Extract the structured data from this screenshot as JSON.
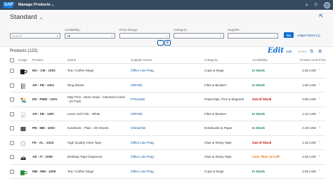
{
  "shell": {
    "logo_text": "SAP",
    "app_title": "Manage Products",
    "icons": [
      "search-icon",
      "notification-icon",
      "user-avatar"
    ]
  },
  "header": {
    "variant": "Standard"
  },
  "filters": [
    {
      "key": "search",
      "label": "",
      "value": "",
      "placeholder": "Search",
      "tail": "⌕"
    },
    {
      "key": "availability",
      "label": "Availability:",
      "value": "All",
      "placeholder": "",
      "tail": "⌄"
    },
    {
      "key": "price_range",
      "label": "Price Range:",
      "value": "",
      "placeholder": "",
      "tail": "⌄"
    },
    {
      "key": "category",
      "label": "Category:",
      "value": "",
      "placeholder": "",
      "tail": "⌄"
    },
    {
      "key": "supplier",
      "label": "Supplier:",
      "value": "",
      "placeholder": "",
      "tail": "⌄"
    }
  ],
  "actions": {
    "go": "Go",
    "adapt_filters": "Adapt Filters (1)"
  },
  "table": {
    "title": "Products (123)",
    "edit_overlay": "Edit",
    "add": "Add",
    "delete": "Delete",
    "columns": [
      "Image",
      "Product",
      "Name",
      "Supplier Name",
      "Category",
      "Availability",
      "Product Unit Price"
    ],
    "rows": [
      {
        "product": "MC - CM - 1003",
        "name": "Tea / Coffee Mugs",
        "supplier": "Office Line Prag",
        "category": "Cups & Mugs",
        "availability": "In Stock",
        "status": "good",
        "price": "2.65 USD",
        "thumb": "mug-black"
      },
      {
        "product": "AR - FB - 1001",
        "name": "Ring Binder",
        "supplier": "ORFON",
        "category": "Files & Binders",
        "availability": "In Stock",
        "status": "good",
        "price": "1.60 USD",
        "thumb": "binder"
      },
      {
        "product": "DE - PMM - 1001",
        "name": "Map Pins - 5mm Head - Assorted Colors - 20 Pack",
        "supplier": "POLinado",
        "category": "Paperclips, Pins & Magnets",
        "availability": "Out of Stock",
        "status": "bad",
        "price": "0.85 USD",
        "thumb": "pins"
      },
      {
        "product": "AR - FB - 1097",
        "name": "Lever Arch File - White",
        "supplier": "ORFON",
        "category": "Files & Binders",
        "availability": "In Stock",
        "status": "good",
        "price": "1.12 USD",
        "thumb": "file-white"
      },
      {
        "product": "PB - MB - 1003",
        "name": "Notebook - Plain - 80 Sheets",
        "supplier": "ChinaChin",
        "category": "Notebooks & Paper",
        "availability": "In Stock",
        "status": "good",
        "price": "2.35 USD",
        "thumb": "notebook"
      },
      {
        "product": "FE - AL - 1234",
        "name": "High Quality Clear Tape",
        "supplier": "Office Line Prag",
        "category": "Glue & Sticky Tape",
        "availability": "Out of Stock",
        "status": "bad",
        "price": "1.45 USD",
        "thumb": "tape"
      },
      {
        "product": "AE - IT - 1009",
        "name": "Desktop Tape Dispencer",
        "supplier": "Office Line Prag",
        "category": "Glue & Sticky Tape",
        "availability": "Less Than 10 Left",
        "status": "warn",
        "price": "4.05 USD",
        "thumb": "dispenser"
      },
      {
        "product": "MB - MM - 1209",
        "name": "Tea / Coffee Mugs",
        "supplier": "Office Line Prag",
        "category": "Cups & Mugs",
        "availability": "In Stock",
        "status": "good",
        "price": "2.55 USD",
        "thumb": "mug-green"
      }
    ]
  },
  "colors": {
    "shell": "#354a5f",
    "brand": "#0a6ed1",
    "link": "#0854a0",
    "positive": "#107e3e",
    "negative": "#bb0000",
    "critical": "#e9730c"
  }
}
